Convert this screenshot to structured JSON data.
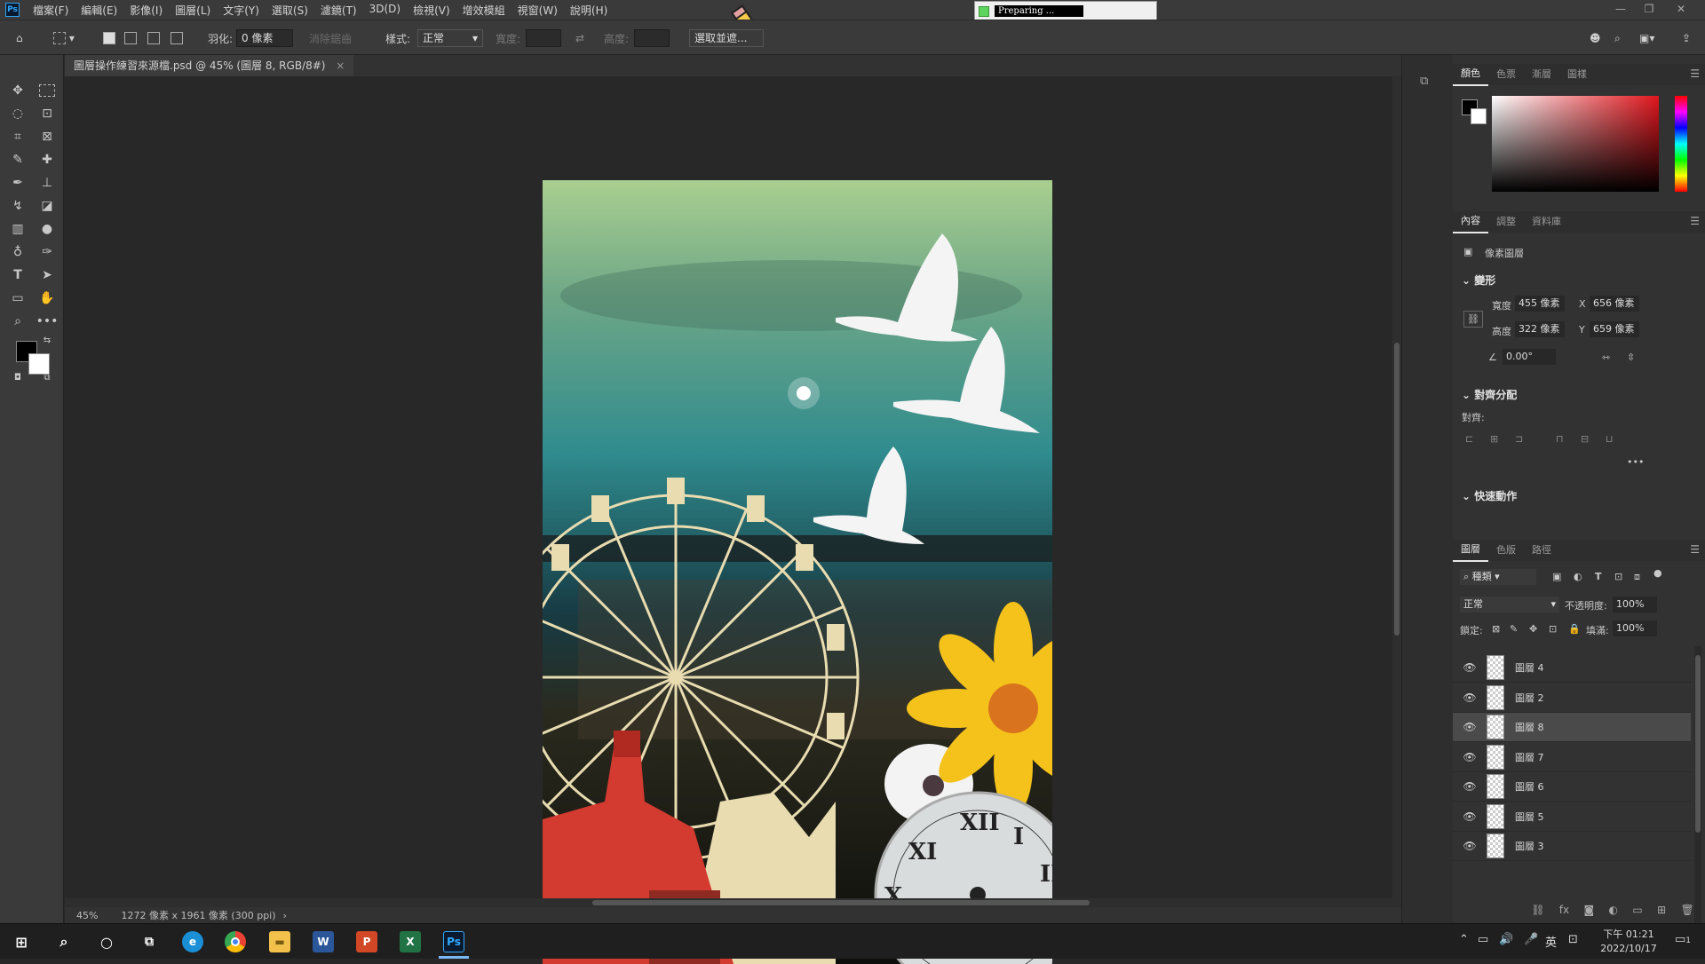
{
  "menu": {
    "app_logo": "Ps",
    "items": [
      "檔案(F)",
      "編輯(E)",
      "影像(I)",
      "圖層(L)",
      "文字(Y)",
      "選取(S)",
      "濾鏡(T)",
      "3D(D)",
      "檢視(V)",
      "增效模組",
      "視窗(W)",
      "說明(H)"
    ]
  },
  "preparing": {
    "text": "Preparing ..."
  },
  "options": {
    "feather_label": "羽化:",
    "feather_value": "0 像素",
    "antialias_label": "消除鋸齒",
    "style_label": "樣式:",
    "style_value": "正常",
    "width_label": "寬度:",
    "height_label": "高度:",
    "select_mask_button": "選取並遮..."
  },
  "document": {
    "tab_title": "圖層操作練習來源檔.psd @ 45% (圖層 8, RGB/8#)",
    "close_glyph": "×"
  },
  "status": {
    "zoom": "45%",
    "doc_info": "1272 像素 x 1961 像素 (300 ppi)"
  },
  "color_panel": {
    "tabs": [
      "顏色",
      "色票",
      "漸層",
      "圖樣"
    ]
  },
  "properties_panel": {
    "tabs": [
      "內容",
      "調整",
      "資料庫"
    ],
    "layer_type": "像素圖層",
    "transform_title": "變形",
    "w_label": "寬度",
    "w_value": "455 像素",
    "h_label": "高度",
    "h_value": "322 像素",
    "x_label": "X",
    "x_value": "656 像素",
    "y_label": "Y",
    "y_value": "659 像素",
    "angle_value": "0.00°",
    "align_title": "對齊分配",
    "align_label": "對齊:",
    "quick_title": "快速動作"
  },
  "layers_panel": {
    "tabs": [
      "圖層",
      "色版",
      "路徑"
    ],
    "filter_value": "種類",
    "blend_mode": "正常",
    "opacity_label": "不透明度:",
    "opacity_value": "100%",
    "lock_label": "鎖定:",
    "fill_label": "填滿:",
    "fill_value": "100%",
    "layers": [
      {
        "name": "圖層 4",
        "selected": false
      },
      {
        "name": "圖層 2",
        "selected": false
      },
      {
        "name": "圖層 8",
        "selected": true
      },
      {
        "name": "圖層 7",
        "selected": false
      },
      {
        "name": "圖層 6",
        "selected": false
      },
      {
        "name": "圖層 5",
        "selected": false
      },
      {
        "name": "圖層 3",
        "selected": false
      }
    ]
  },
  "taskbar": {
    "clock_time": "下午 01:21",
    "clock_date": "2022/10/17",
    "ime": "英",
    "notification_count": "1",
    "apps": [
      "W",
      "P",
      "X",
      "Ps"
    ]
  }
}
